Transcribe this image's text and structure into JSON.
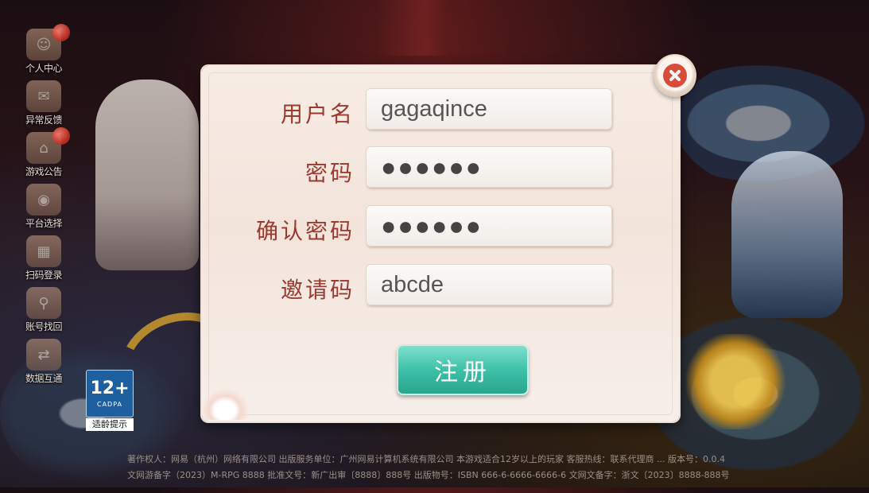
{
  "sidebar": {
    "items": [
      {
        "label": "个人中心",
        "icon": "user-icon",
        "badge": true
      },
      {
        "label": "异常反馈",
        "icon": "feedback-icon",
        "badge": false
      },
      {
        "label": "游戏公告",
        "icon": "home-icon",
        "badge": true
      },
      {
        "label": "平台选择",
        "icon": "apple-icon",
        "badge": false
      },
      {
        "label": "扫码登录",
        "icon": "scan-icon",
        "badge": false
      },
      {
        "label": "账号找回",
        "icon": "search-account-icon",
        "badge": false
      },
      {
        "label": "数据互通",
        "icon": "sync-icon",
        "badge": false
      }
    ]
  },
  "age_badge": {
    "number": "12+",
    "sub": "CADPA",
    "caption": "适龄提示"
  },
  "form": {
    "username_label": "用户名",
    "username_value": "gagaqince",
    "password_label": "密码",
    "password_value": "●●●●●●",
    "confirm_label": "确认密码",
    "confirm_value": "●●●●●●",
    "invite_label": "邀请码",
    "invite_value": "abcde",
    "submit_label": "注册"
  },
  "footer": {
    "line1": "著作权人：网易（杭州）网络有限公司 出版服务单位：广州网易计算机系统有限公司 本游戏适合12岁以上的玩家 客服热线：联系代理商 ... 版本号：0.0.4",
    "line2": "文网游备字（2023）M-RPG 8888  批准文号：新广出审〔8888〕888号  出版物号：ISBN 666-6-6666-6666-6  文网文备字：浙文〔2023〕8888-888号"
  },
  "colors": {
    "label": "#9b3a2e",
    "accent_button": "#3ec0a8",
    "close": "#d84a3a",
    "badge_blue": "#1e5fa0"
  }
}
